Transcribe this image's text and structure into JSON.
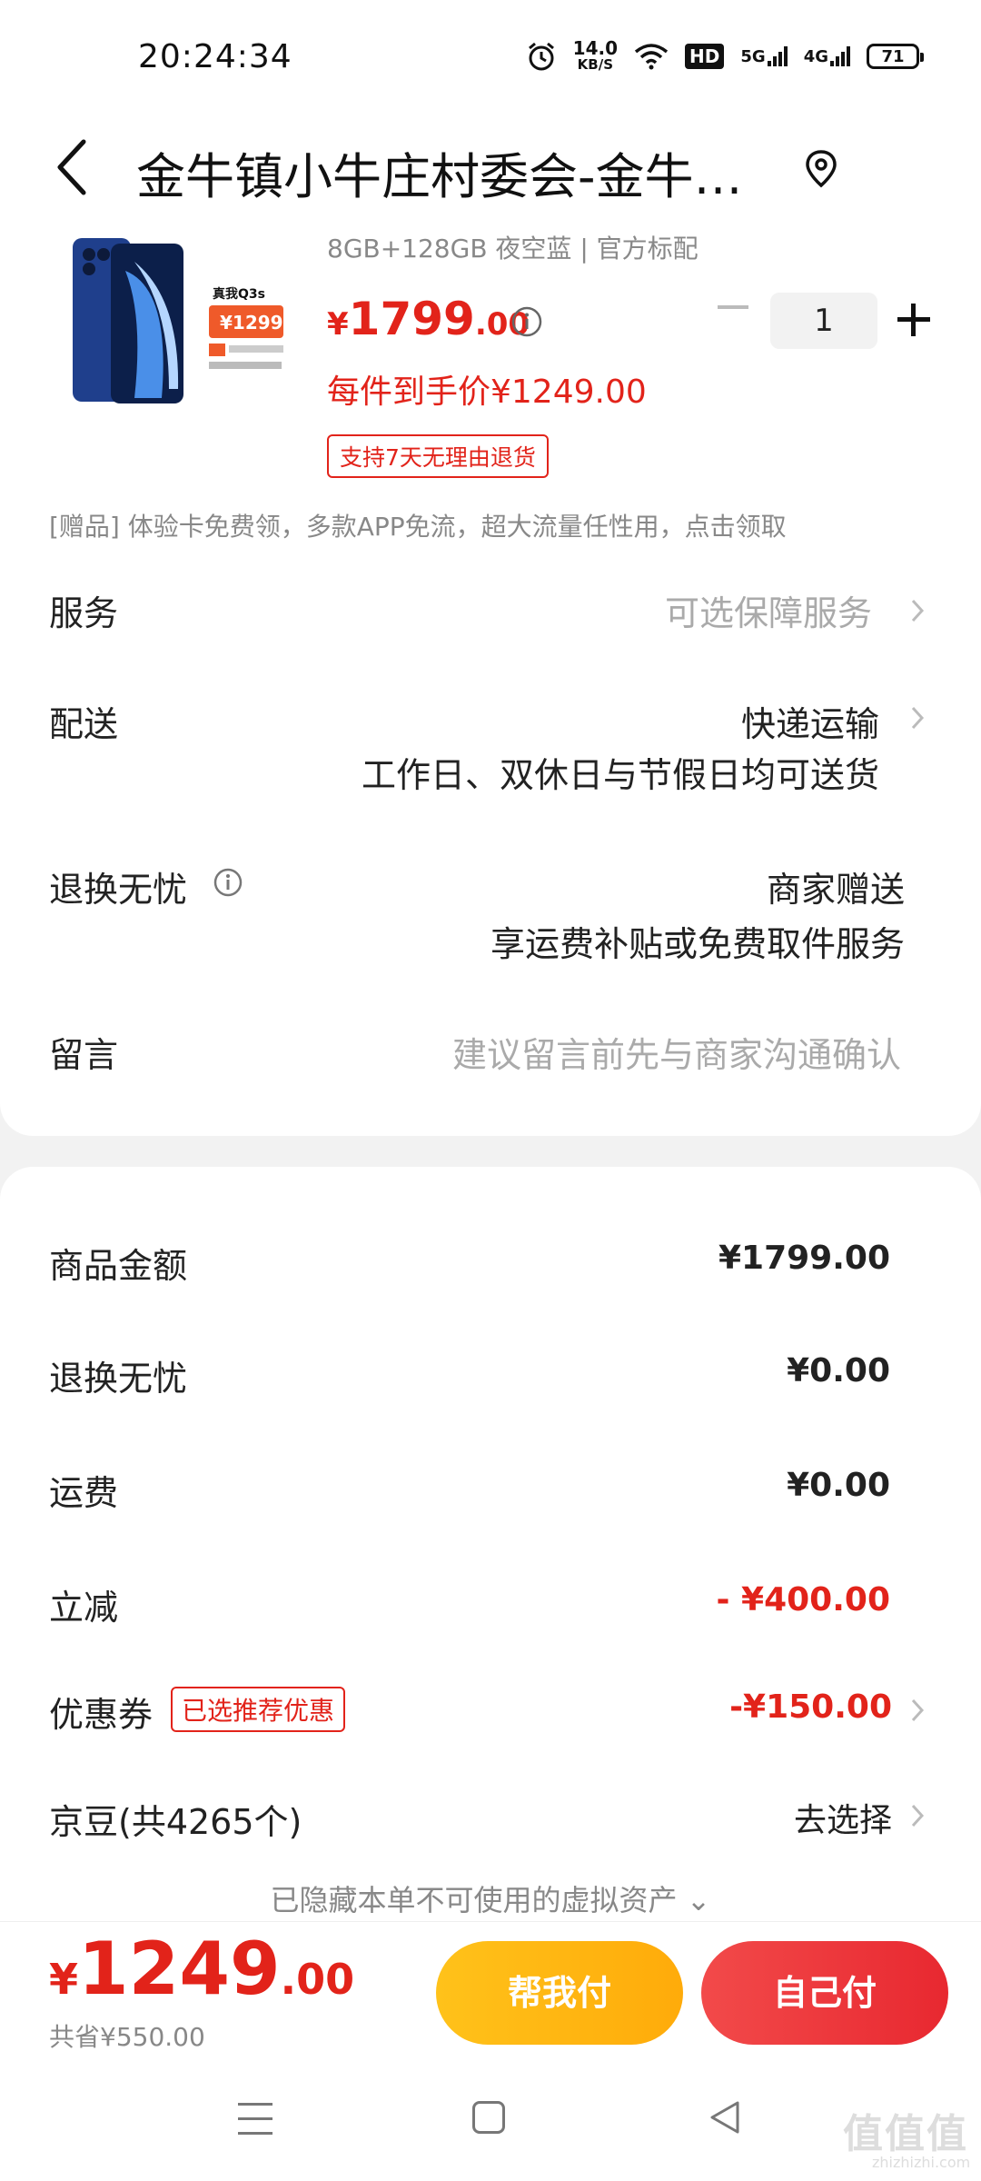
{
  "status_bar": {
    "time": "20:24:34",
    "speed_value": "14.0",
    "speed_unit": "KB/S",
    "hd_label": "HD",
    "net1": "5G",
    "net2": "4G",
    "battery": "71"
  },
  "header": {
    "address": "金牛镇小牛庄村委会-金牛…"
  },
  "product": {
    "spec": "8GB+128GB 夜空蓝 | 官方标配",
    "price_symbol": "¥",
    "price_int": "1799",
    "price_dec": ".00",
    "hand_price": "每件到手价¥1249.00",
    "return_tag": "支持7天无理由退货",
    "quantity": "1",
    "image_text_brand": "真我Q3s",
    "image_text_price": "¥1299"
  },
  "gift": "[赠品]  体验卡免费领，多款APP免流，超大流量任性用，点击领取",
  "rows": {
    "service_label": "服务",
    "service_value": "可选保障服务",
    "delivery_label": "配送",
    "delivery_value": "快递运输",
    "delivery_note": "工作日、双休日与节假日均可送货",
    "worry_label": "退换无忧",
    "worry_value": "商家赠送",
    "worry_note": "享运费补贴或免费取件服务",
    "message_label": "留言",
    "message_placeholder": "建议留言前先与商家沟通确认"
  },
  "summary": {
    "goods_label": "商品金额",
    "goods_value": "¥1799.00",
    "worry_label": "退换无忧",
    "worry_value": "¥0.00",
    "shipping_label": "运费",
    "shipping_value": "¥0.00",
    "discount_label": "立减",
    "discount_value": "- ¥400.00",
    "coupon_label": "优惠券",
    "coupon_tag": "已选推荐优惠",
    "coupon_value": "-¥150.00",
    "jingdou_label": "京豆(共4265个)",
    "jingdou_value": "去选择",
    "hidden_assets": "已隐藏本单不可使用的虚拟资产 ⌄"
  },
  "bottom": {
    "total_symbol": "¥",
    "total_int": "1249",
    "total_dec": ".00",
    "saved": "共省¥550.00",
    "help_pay": "帮我付",
    "self_pay": "自己付"
  },
  "watermark": "值值值",
  "watermark_sub": "zhizhizhi.com",
  "colors": {
    "accent_red": "#e2231a",
    "help_button": "#ffb511",
    "pay_button": "#ec3237"
  }
}
